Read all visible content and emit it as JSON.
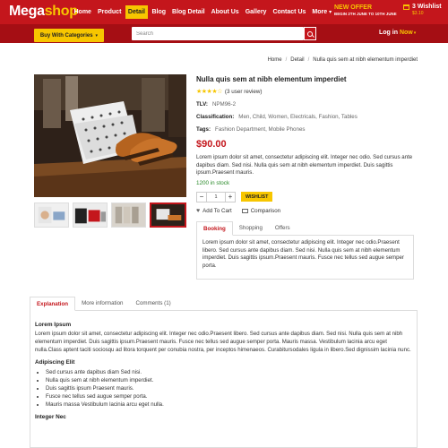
{
  "brand": {
    "name_main": "Mega",
    "name_accent": "shop",
    "primary_color": "#c4161c",
    "accent_color": "#f7c600"
  },
  "nav": {
    "items": [
      {
        "label": "Home"
      },
      {
        "label": "Product"
      },
      {
        "label": "Detail",
        "active": true
      },
      {
        "label": "Blog"
      },
      {
        "label": "Blog Detail"
      },
      {
        "label": "About Us"
      },
      {
        "label": "Gallery"
      },
      {
        "label": "Contact Us"
      },
      {
        "label": "More"
      }
    ]
  },
  "offer": {
    "title": "NEW OFFER",
    "subtitle": "BEGIN 2TH JUNE TO 10TH JUNE"
  },
  "wishlist": {
    "label": "3 Wishlist",
    "price": "$3.10"
  },
  "category_button": {
    "label": "Buy With Categories"
  },
  "search": {
    "placeholder": "Search"
  },
  "login": {
    "label": "Log in",
    "now": "Now"
  },
  "breadcrumb": {
    "items": [
      "Home",
      "Detail",
      "Nulla quis sem at nibh elementum imperdiet"
    ],
    "separator": "/"
  },
  "product": {
    "title": "Nulla quis sem at nibh elementum imperdiet",
    "stars": "★★★★☆",
    "rating_text": "(3 user review)",
    "tlv_label": "TLV:",
    "tlv_value": "NPM96-2",
    "classification_label": "Classification:",
    "classification_value": "Men, Child, Women, Electricals, Fashion, Tables",
    "tags_label": "Tags:",
    "tags_value": "Fashion Department, Mobile Phones",
    "price": "$90.00",
    "description": "Lorem ipsum dolor sit amet, consectetur adipiscing elit. Integer nec odio. Sed cursus ante dapibus diam. Sed nisi. Nulla quis sem at nibh elementum imperdiet. Duis sagittis ipsum.Praesent mauris.",
    "stock": "1200 in stock",
    "quantity": "1",
    "minus": "−",
    "plus": "+",
    "wishlist_button": "WISHLIST",
    "add_to_cart": "Add To Cart",
    "comparison": "Comparison"
  },
  "info_tabs": {
    "tabs": [
      {
        "label": "Booking",
        "active": true
      },
      {
        "label": "Shopping"
      },
      {
        "label": "Offers"
      }
    ],
    "content": "Lorem ipsum dolor sit amet, consectetur adipiscing elit. Integer nec odio.Praesent libero. Sed cursus ante dapibus diam. Sed nisi. Nulla quis sem at nibh elementum imperdiet. Duis sagittis ipsum.Praesent mauris. Fusce nec tellus sed augue semper porta."
  },
  "details_tabs": {
    "tabs": [
      {
        "label": "Explanation",
        "active": true
      },
      {
        "label": "More information"
      },
      {
        "label": "Comments (1)"
      }
    ],
    "heading1": "Lorem Ipsum",
    "paragraph1": "Lorem ipsum dolor sit amet, consectetur adipiscing elit. Integer nec odio.Praesent libero. Sed cursus ante dapibus diam. Sed nisi. Nulla quis sem at nibh elementum imperdiet. Duis sagittis ipsum.Praesent mauris. Fusce nec tellus sed augue semper porta. Mauris massa. Vestibulum lacinia arcu eget nulla.Class aptent taciti sociosqu ad litora torquent per conubia nostra, per inceptos himenaeos. Curabitursodales ligula in libero.Sed dignissim lacinia nunc.",
    "heading2": "Adipiscing Elit",
    "list": [
      "Sed cursus ante dapibus diam Sed nisi.",
      "Nulla quis sem at nibh elementum imperdiet.",
      "Duis sagittis ipsum Praesent mauris.",
      "Fusce nec tellus sed augue semper porta.",
      "Mauris massa Vestibulum lacinia arcu eget nulla."
    ],
    "heading3": "Integer Nec"
  }
}
